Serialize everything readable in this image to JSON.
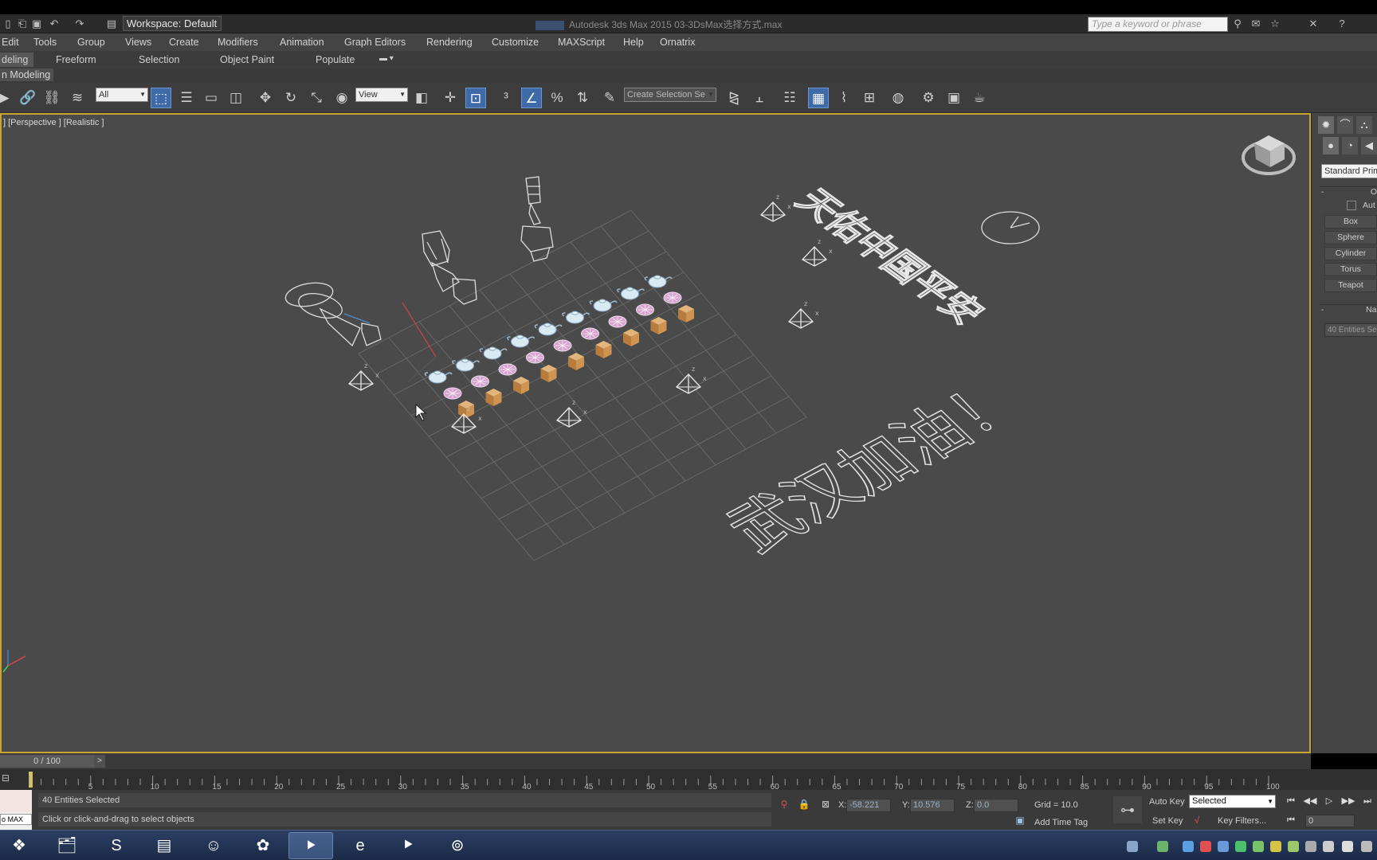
{
  "titlebar": {
    "workspace": "Workspace: Default",
    "app_title": "Autodesk 3ds Max  2015    03-3DsMax选择方式.max",
    "search_placeholder": "Type a keyword or phrase"
  },
  "menu": [
    "Edit",
    "Tools",
    "Group",
    "Views",
    "Create",
    "Modifiers",
    "Animation",
    "Graph Editors",
    "Rendering",
    "Customize",
    "MAXScript",
    "Help",
    "Ornatrix"
  ],
  "ribbon": {
    "tabs": [
      "deling",
      "Freeform",
      "Selection",
      "Object Paint",
      "Populate"
    ],
    "sub_label": "n Modeling"
  },
  "toolbar": {
    "filter_dropdown": "All",
    "ref_coord_dropdown": "View",
    "selection_set_dropdown": "Create Selection Se"
  },
  "viewport": {
    "label": "] [Perspective ] [Realistic ]",
    "text_3d_top": "天佑中国平安",
    "text_3d_bottom": "武汉加油！"
  },
  "command_panel": {
    "dropdown": "Standard Primi",
    "object_type_rollout": "Obje",
    "autogrid": "Aut",
    "object_buttons": [
      "Box",
      "Sphere",
      "Cylinder",
      "Torus",
      "Teapot"
    ],
    "name_rollout": "Name",
    "name_field": "40 Entities Se"
  },
  "timeline": {
    "slider_label": "0 / 100",
    "next_label": ">",
    "ticks": [
      "5",
      "10",
      "15",
      "20",
      "25",
      "30",
      "35",
      "40",
      "45",
      "50",
      "55",
      "60",
      "65",
      "70",
      "75",
      "80",
      "85",
      "90",
      "95",
      "100"
    ]
  },
  "status": {
    "maxscript_mini": "o  MAX",
    "selection_info": "40 Entities Selected",
    "prompt": "Click or click-and-drag to select objects",
    "x_label": "X:",
    "x_value": "-58.221",
    "y_label": "Y:",
    "y_value": "10.576",
    "z_label": "Z:",
    "z_value": "0.0",
    "grid": "Grid = 10.0",
    "add_time_tag": "Add Time Tag",
    "auto_key": "Auto Key",
    "set_key": "Set Key",
    "key_filters": "Key Filters...",
    "selected_dropdown": "Selected",
    "frame": "0"
  },
  "colors": {
    "viewport_bg": "#4a4a4a",
    "viewport_border": "#c8a434",
    "accent_blue": "#3e6aa8",
    "box_orange": "#c8894a"
  }
}
